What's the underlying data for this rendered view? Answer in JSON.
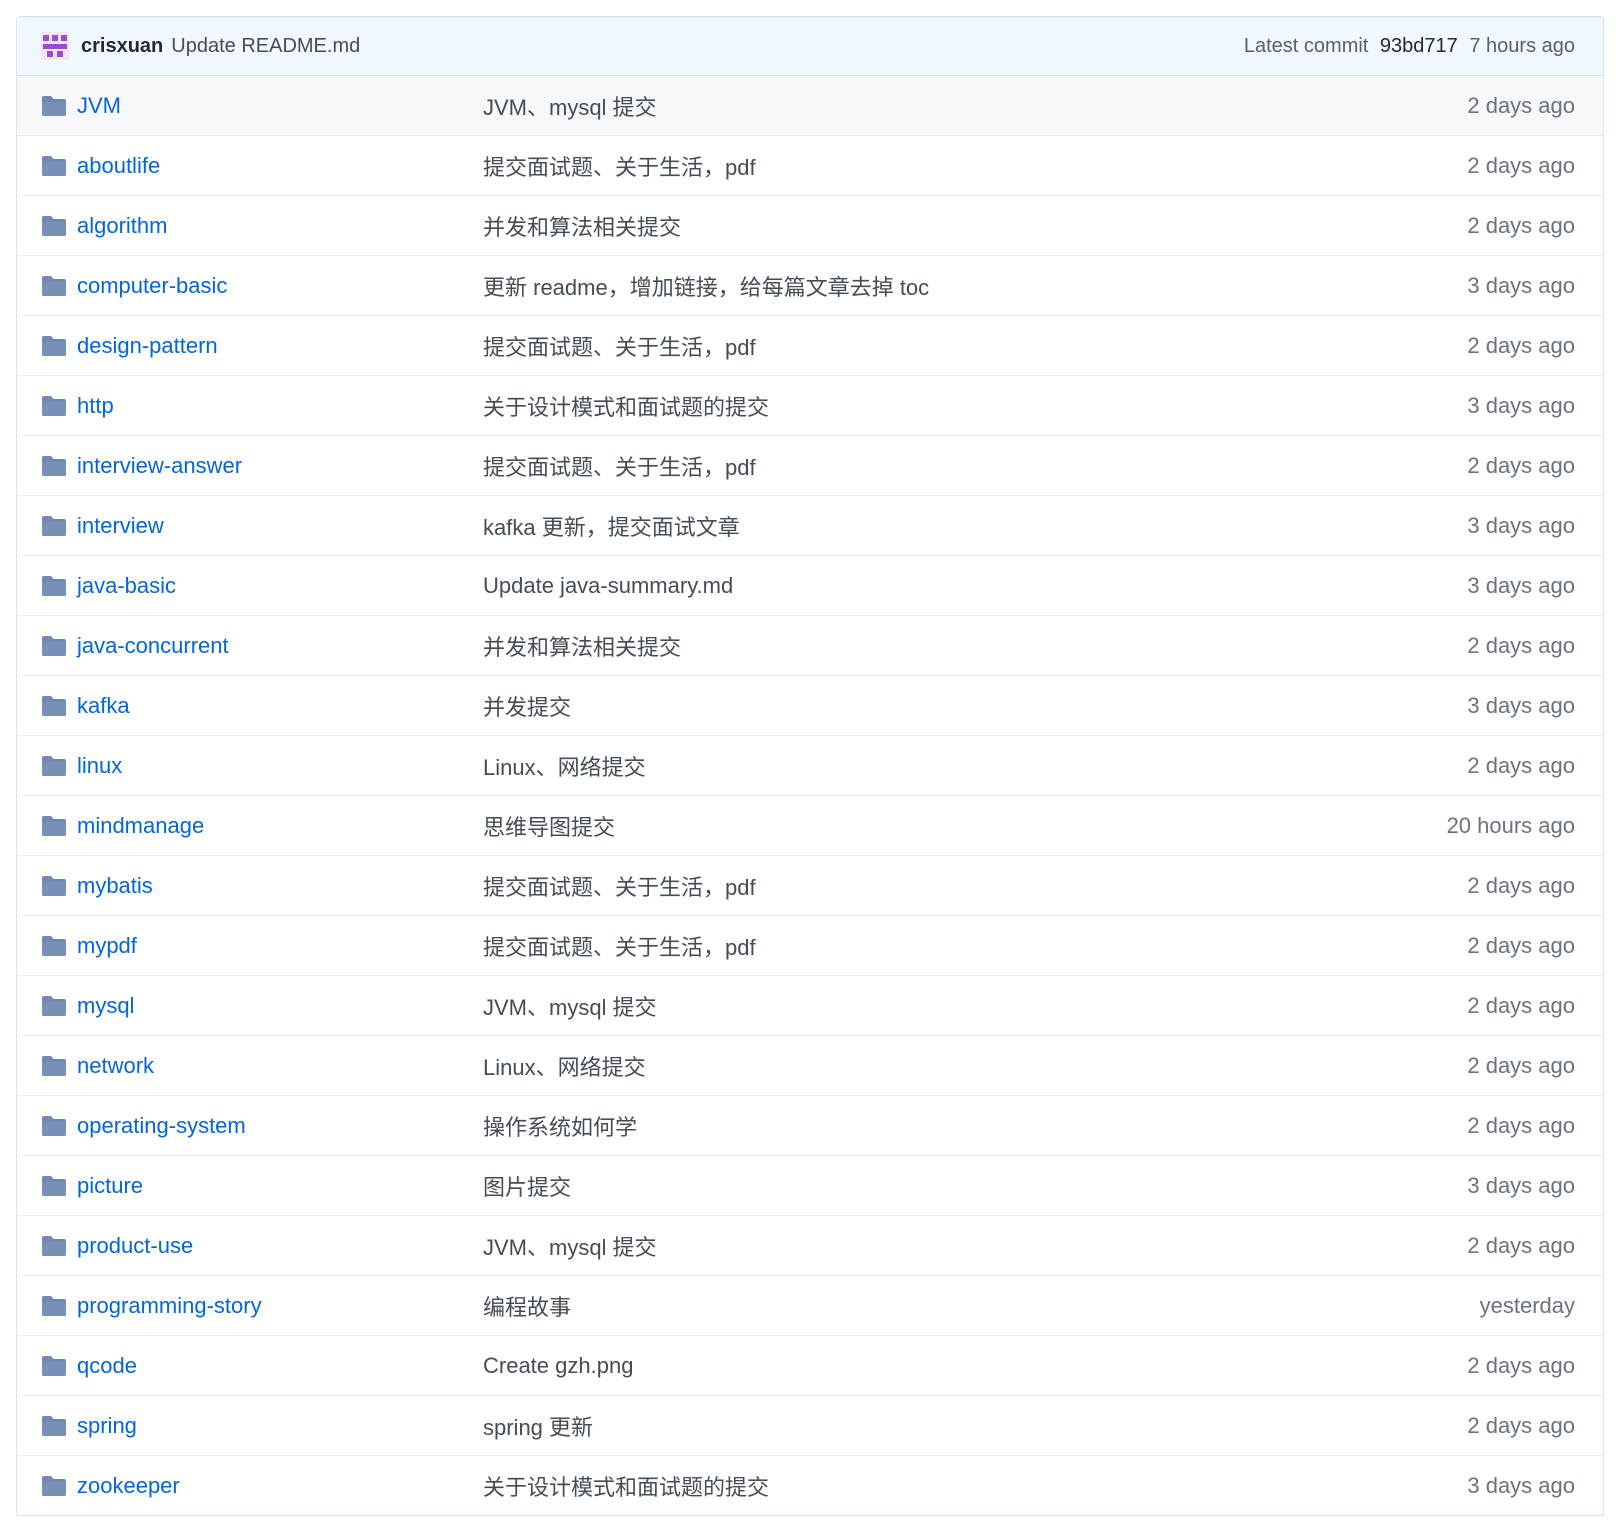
{
  "colors": {
    "link": "#0366d6",
    "folder_icon": "#79b8ff",
    "commit_bar_bg": "#f1f8ff",
    "avatar": "#9b4dca"
  },
  "latest_commit": {
    "avatar_icon": "avatar-icon",
    "author": "crisxuan",
    "message": "Update README.md",
    "label": "Latest commit",
    "sha": "93bd717",
    "age": "7 hours ago"
  },
  "files": [
    {
      "name": "JVM",
      "message": "JVM、mysql 提交",
      "age": "2 days ago",
      "icon": "folder-icon"
    },
    {
      "name": "aboutlife",
      "message": "提交面试题、关于生活，pdf",
      "age": "2 days ago",
      "icon": "folder-icon"
    },
    {
      "name": "algorithm",
      "message": "并发和算法相关提交",
      "age": "2 days ago",
      "icon": "folder-icon"
    },
    {
      "name": "computer-basic",
      "message": "更新 readme，增加链接，给每篇文章去掉 toc",
      "age": "3 days ago",
      "icon": "folder-icon"
    },
    {
      "name": "design-pattern",
      "message": "提交面试题、关于生活，pdf",
      "age": "2 days ago",
      "icon": "folder-icon"
    },
    {
      "name": "http",
      "message": "关于设计模式和面试题的提交",
      "age": "3 days ago",
      "icon": "folder-icon"
    },
    {
      "name": "interview-answer",
      "message": "提交面试题、关于生活，pdf",
      "age": "2 days ago",
      "icon": "folder-icon"
    },
    {
      "name": "interview",
      "message": "kafka 更新，提交面试文章",
      "age": "3 days ago",
      "icon": "folder-icon"
    },
    {
      "name": "java-basic",
      "message": "Update java-summary.md",
      "age": "3 days ago",
      "icon": "folder-icon"
    },
    {
      "name": "java-concurrent",
      "message": "并发和算法相关提交",
      "age": "2 days ago",
      "icon": "folder-icon"
    },
    {
      "name": "kafka",
      "message": "并发提交",
      "age": "3 days ago",
      "icon": "folder-icon"
    },
    {
      "name": "linux",
      "message": "Linux、网络提交",
      "age": "2 days ago",
      "icon": "folder-icon"
    },
    {
      "name": "mindmanage",
      "message": "思维导图提交",
      "age": "20 hours ago",
      "icon": "folder-icon"
    },
    {
      "name": "mybatis",
      "message": "提交面试题、关于生活，pdf",
      "age": "2 days ago",
      "icon": "folder-icon"
    },
    {
      "name": "mypdf",
      "message": "提交面试题、关于生活，pdf",
      "age": "2 days ago",
      "icon": "folder-icon"
    },
    {
      "name": "mysql",
      "message": "JVM、mysql 提交",
      "age": "2 days ago",
      "icon": "folder-icon"
    },
    {
      "name": "network",
      "message": "Linux、网络提交",
      "age": "2 days ago",
      "icon": "folder-icon"
    },
    {
      "name": "operating-system",
      "message": "操作系统如何学",
      "age": "2 days ago",
      "icon": "folder-icon"
    },
    {
      "name": "picture",
      "message": "图片提交",
      "age": "3 days ago",
      "icon": "folder-icon"
    },
    {
      "name": "product-use",
      "message": "JVM、mysql 提交",
      "age": "2 days ago",
      "icon": "folder-icon"
    },
    {
      "name": "programming-story",
      "message": "编程故事",
      "age": "yesterday",
      "icon": "folder-icon"
    },
    {
      "name": "qcode",
      "message": "Create gzh.png",
      "age": "2 days ago",
      "icon": "folder-icon"
    },
    {
      "name": "spring",
      "message": "spring 更新",
      "age": "2 days ago",
      "icon": "folder-icon"
    },
    {
      "name": "zookeeper",
      "message": "关于设计模式和面试题的提交",
      "age": "3 days ago",
      "icon": "folder-icon"
    }
  ]
}
